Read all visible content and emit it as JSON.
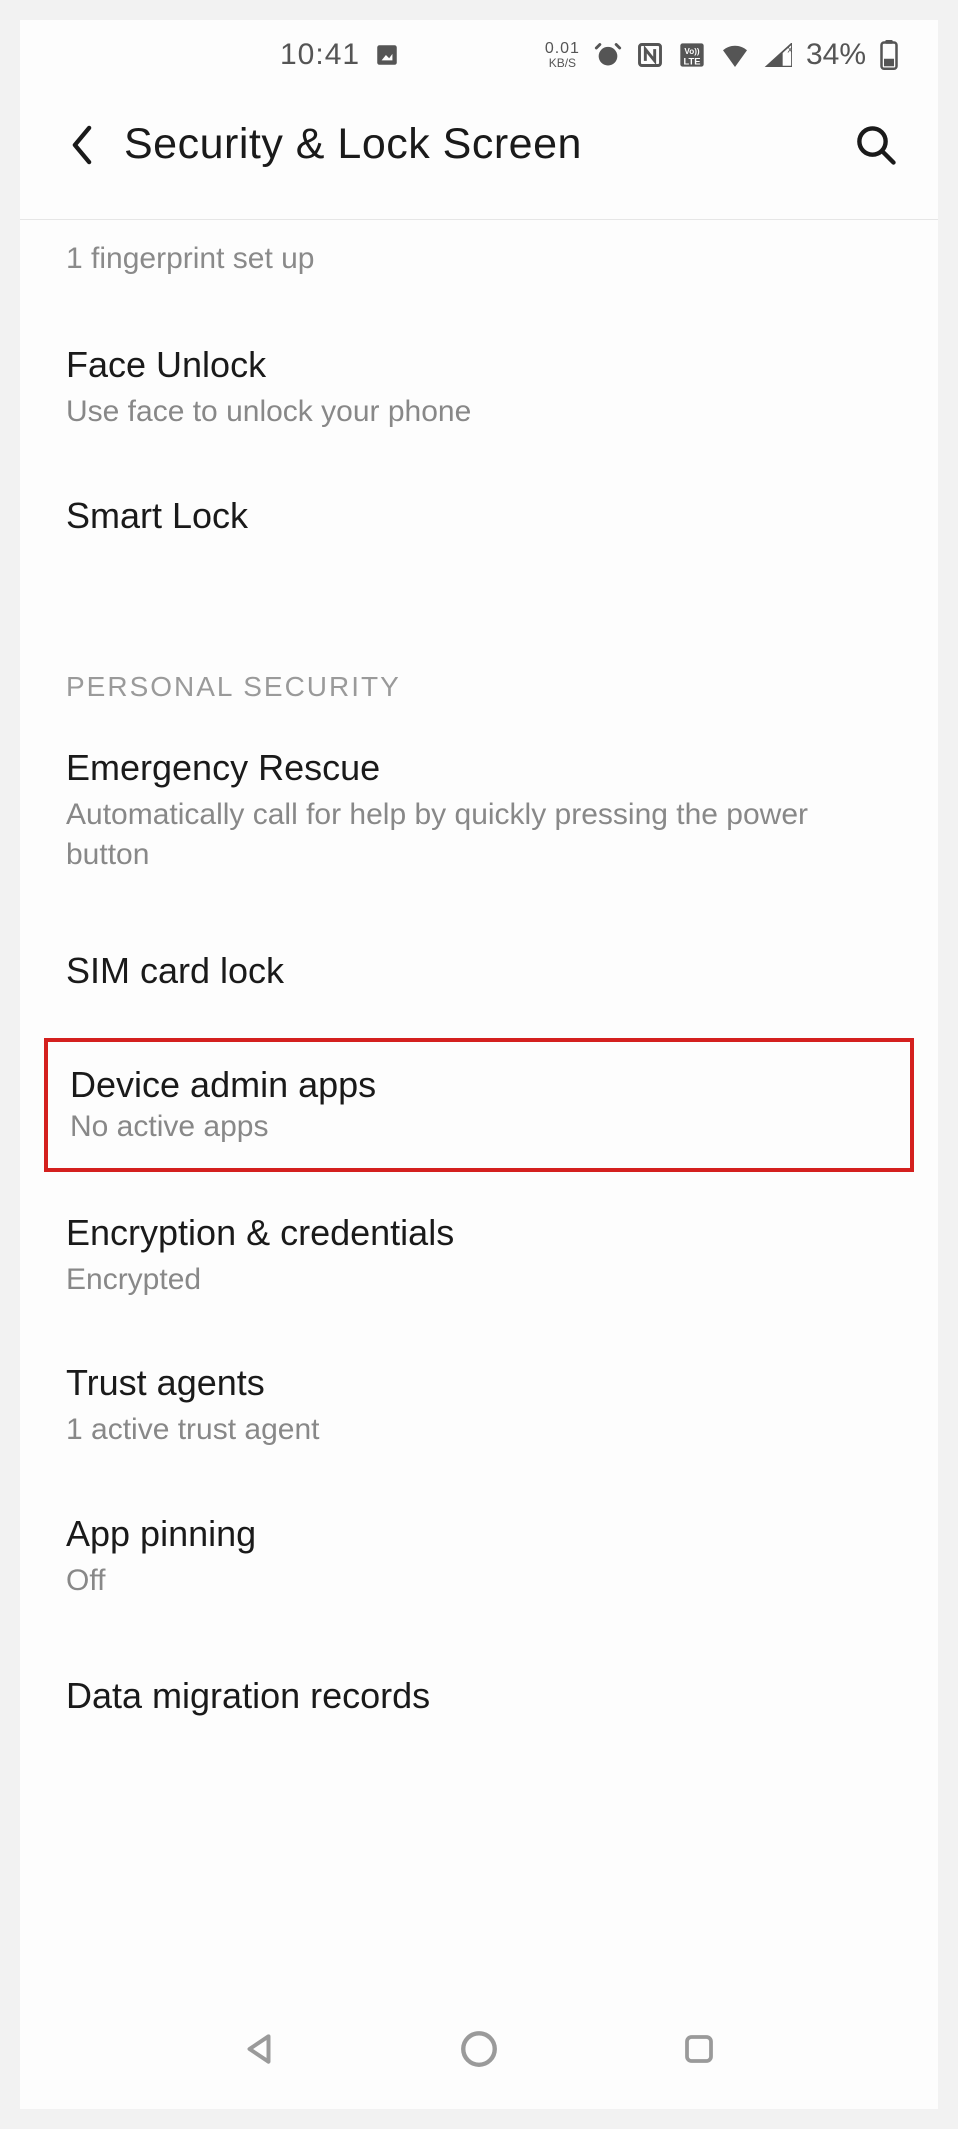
{
  "status": {
    "time": "10:41",
    "speed_top": "0.01",
    "speed_bot": "KB/S",
    "battery_pct": "34%"
  },
  "header": {
    "title": "Security & Lock Screen"
  },
  "top_sub": "1 fingerprint set up",
  "items": {
    "face_unlock": {
      "title": "Face Unlock",
      "sub": "Use face to unlock your phone"
    },
    "smart_lock": {
      "title": "Smart Lock"
    },
    "emergency": {
      "title": "Emergency Rescue",
      "sub": "Automatically call for help by quickly pressing the power button"
    },
    "sim": {
      "title": "SIM card lock"
    },
    "device_admin": {
      "title": "Device admin apps",
      "sub": "No active apps"
    },
    "encryption": {
      "title": "Encryption & credentials",
      "sub": "Encrypted"
    },
    "trust": {
      "title": "Trust agents",
      "sub": "1 active trust agent"
    },
    "pin": {
      "title": "App pinning",
      "sub": "Off"
    },
    "data": {
      "title": "Data migration records"
    }
  },
  "section_label": "PERSONAL SECURITY"
}
